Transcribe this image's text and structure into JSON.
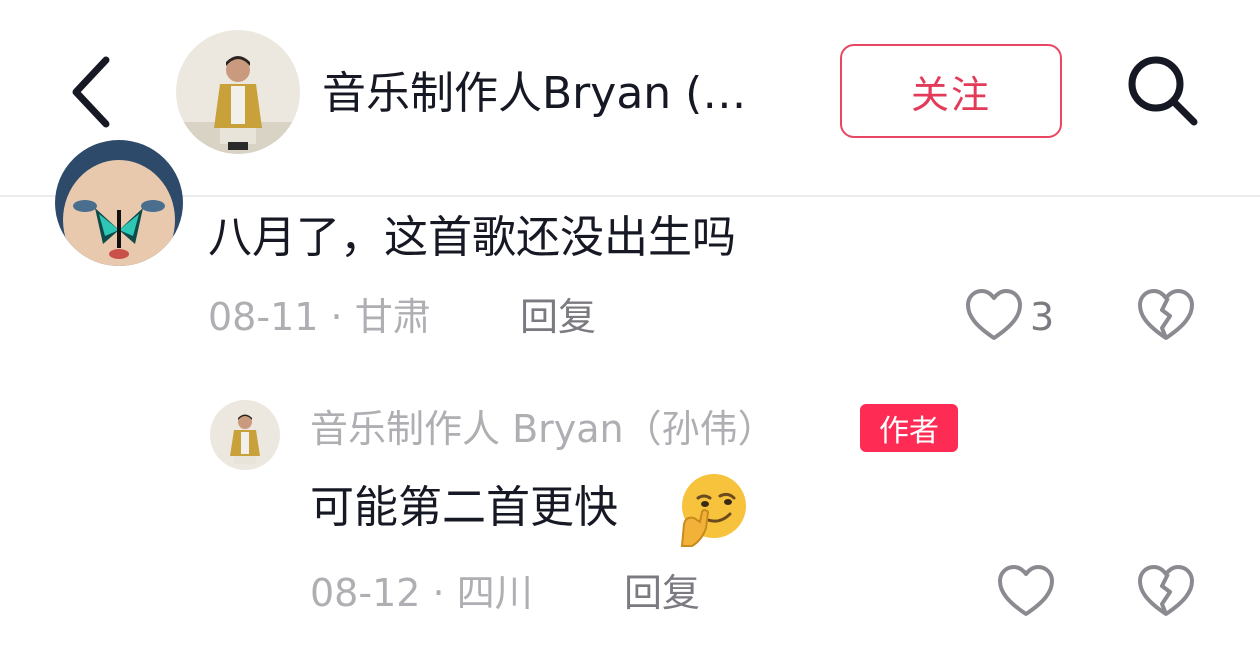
{
  "header": {
    "title": "音乐制作人Bryan (…",
    "follow_label": "关注",
    "icons": {
      "back": "back-chevron-icon",
      "search": "search-icon"
    }
  },
  "comment": {
    "text": "八月了，这首歌还没出生吗",
    "date": "08-11",
    "location": "甘肃",
    "reply_label": "回复",
    "like_count": "3"
  },
  "reply": {
    "author": "音乐制作人 Bryan（孙伟）",
    "badge": "作者",
    "text": "可能第二首更快",
    "emoji": "thinking-smirk-emoji",
    "date": "08-12",
    "location": "四川",
    "reply_label": "回复"
  },
  "colors": {
    "accent": "#fe2c55",
    "follow_border": "#e84764",
    "text": "#161823",
    "meta": "#aeaeb3"
  }
}
